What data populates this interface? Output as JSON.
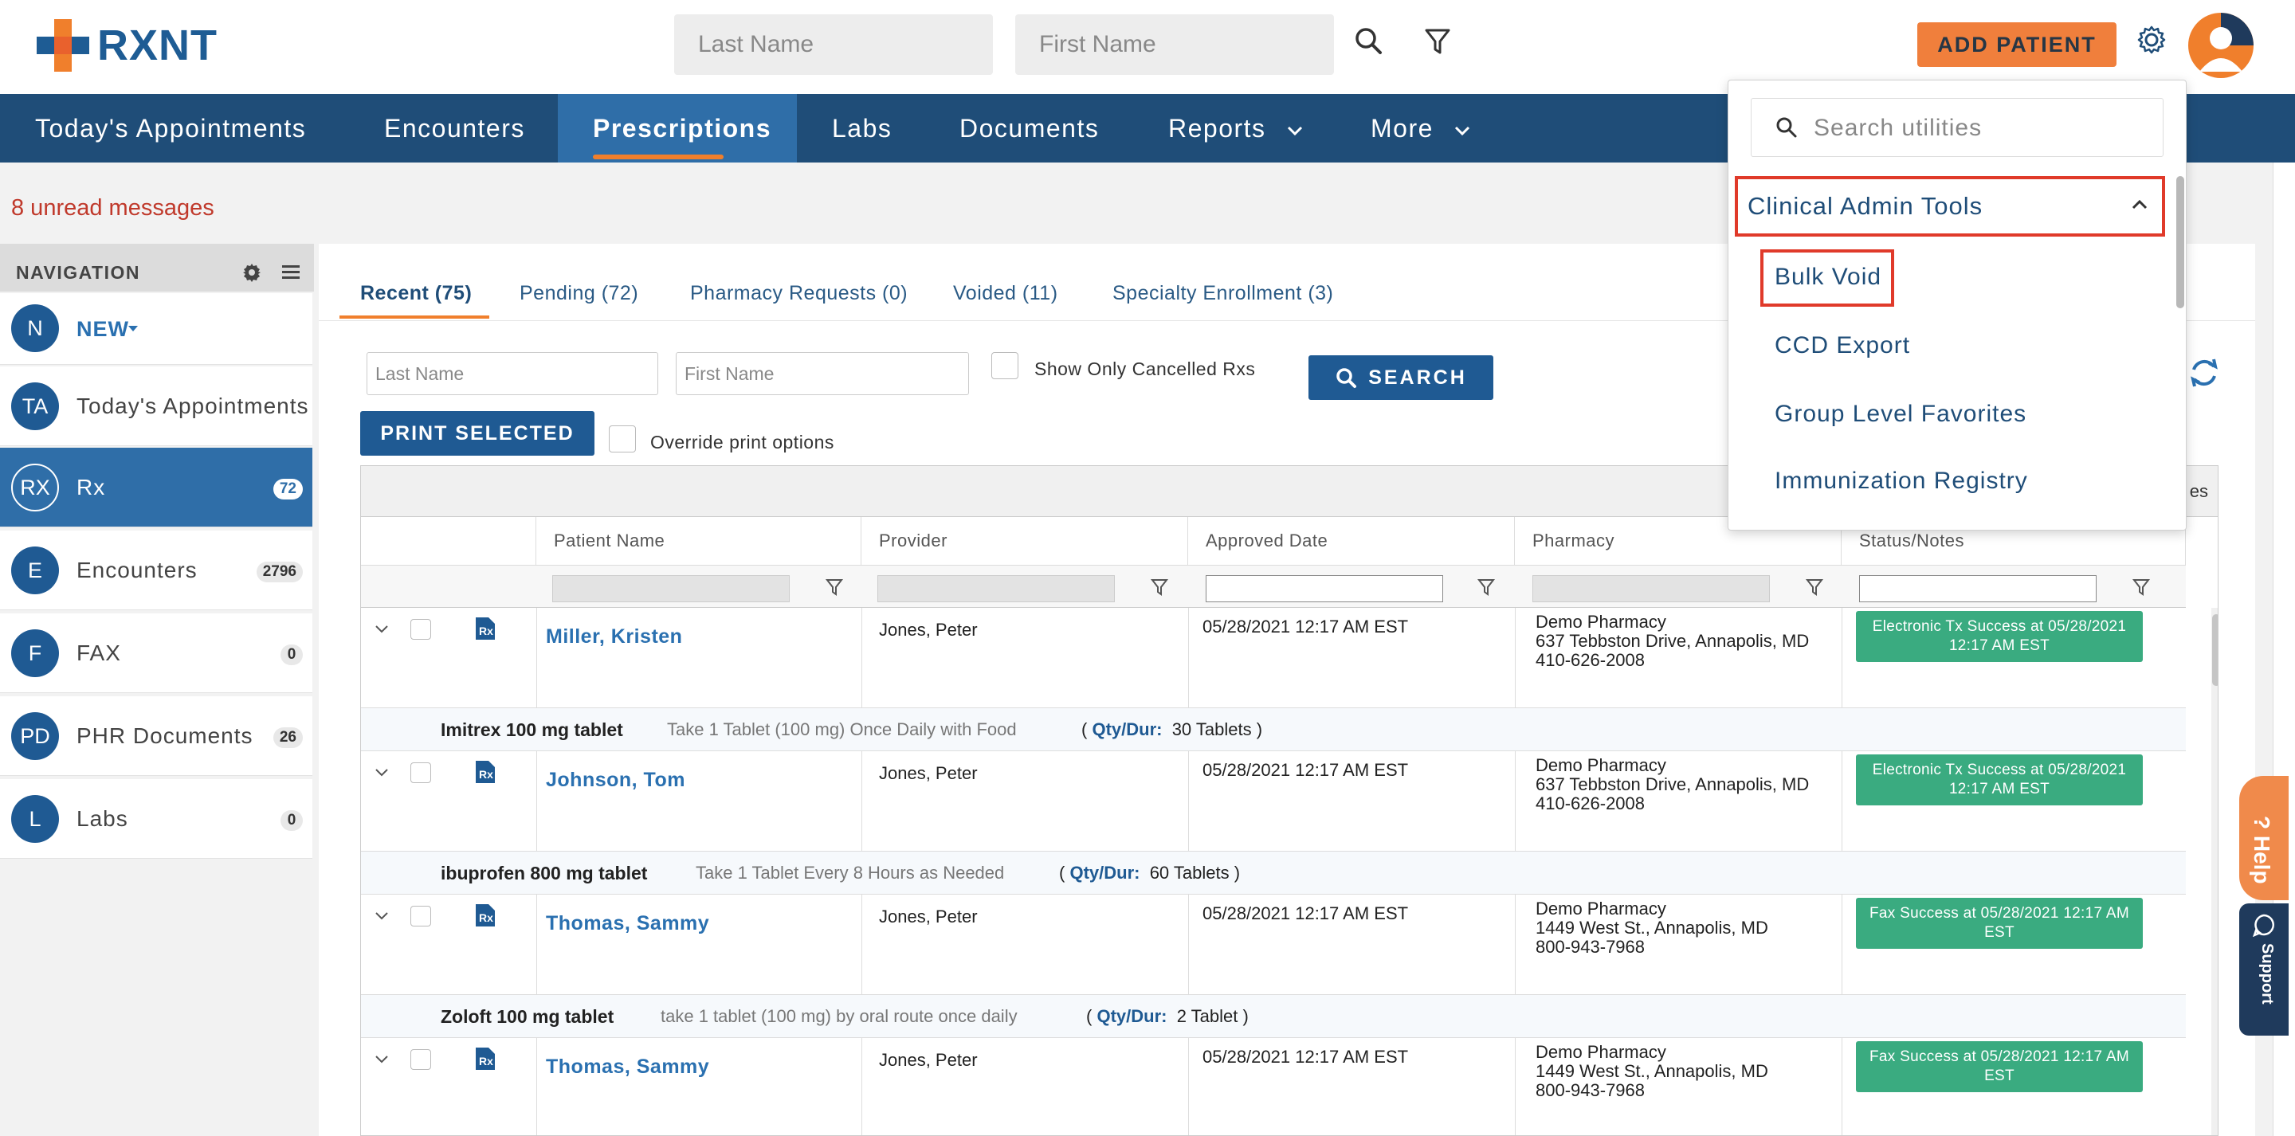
{
  "header": {
    "logo_text": "RXNT",
    "last_name_placeholder": "Last Name",
    "first_name_placeholder": "First Name",
    "add_patient_label": "ADD PATIENT"
  },
  "main_nav": [
    {
      "label": "Today's Appointments"
    },
    {
      "label": "Encounters"
    },
    {
      "label": "Prescriptions"
    },
    {
      "label": "Labs"
    },
    {
      "label": "Documents"
    },
    {
      "label": "Reports"
    },
    {
      "label": "More"
    }
  ],
  "unread_messages": "8 unread messages",
  "left_nav": {
    "title": "NAVIGATION",
    "new_label": "NEW",
    "items": [
      {
        "abbr": "N",
        "label": "NEW"
      },
      {
        "abbr": "TA",
        "label": "Today's Appointments",
        "count": ""
      },
      {
        "abbr": "RX",
        "label": "Rx",
        "count": "72"
      },
      {
        "abbr": "E",
        "label": "Encounters",
        "count": "2796"
      },
      {
        "abbr": "F",
        "label": "FAX",
        "count": "0"
      },
      {
        "abbr": "PD",
        "label": "PHR Documents",
        "count": "26"
      },
      {
        "abbr": "L",
        "label": "Labs",
        "count": "0"
      }
    ]
  },
  "tabs": [
    {
      "label": "Recent (75)"
    },
    {
      "label": "Pending (72)"
    },
    {
      "label": "Pharmacy Requests (0)"
    },
    {
      "label": "Voided (11)"
    },
    {
      "label": "Specialty Enrollment (3)"
    }
  ],
  "filters": {
    "last_name_placeholder": "Last Name",
    "first_name_placeholder": "First Name",
    "cancelled_label": "Show Only Cancelled Rxs",
    "search_label": "SEARCH",
    "print_label": "PRINT SELECTED",
    "override_label": "Override print options"
  },
  "grid": {
    "right_fragment": "es",
    "columns": [
      "Patient Name",
      "Provider",
      "Approved Date",
      "Pharmacy",
      "Status/Notes"
    ],
    "rows": [
      {
        "patient": "Miller, Kristen",
        "provider": "Jones, Peter",
        "date": "05/28/2021 12:17 AM EST",
        "pharmacy_name": "Demo Pharmacy",
        "pharmacy_addr": "637 Tebbston Drive, Annapolis, MD",
        "pharmacy_phone": "410-626-2008",
        "status_line1": "Electronic Tx Success at 05/28/2021",
        "status_line2": "12:17 AM EST",
        "drug": "Imitrex 100 mg tablet",
        "sig": "Take 1 Tablet (100 mg) Once Daily with Food",
        "qty_label": "Qty/Dur:",
        "qty": "30 Tablets"
      },
      {
        "patient": "Johnson, Tom",
        "provider": "Jones, Peter",
        "date": "05/28/2021 12:17 AM EST",
        "pharmacy_name": "Demo Pharmacy",
        "pharmacy_addr": "637 Tebbston Drive, Annapolis, MD",
        "pharmacy_phone": "410-626-2008",
        "status_line1": "Electronic Tx Success at 05/28/2021",
        "status_line2": "12:17 AM EST",
        "drug": "ibuprofen 800 mg tablet",
        "sig": "Take 1 Tablet Every 8 Hours as Needed",
        "qty_label": "Qty/Dur:",
        "qty": "60 Tablets"
      },
      {
        "patient": "Thomas, Sammy",
        "provider": "Jones, Peter",
        "date": "05/28/2021 12:17 AM EST",
        "pharmacy_name": "Demo Pharmacy",
        "pharmacy_addr": "1449 West St., Annapolis, MD",
        "pharmacy_phone": "800-943-7968",
        "status_line1": "Fax Success at 05/28/2021 12:17 AM",
        "status_line2": "EST",
        "drug": "Zoloft 100 mg tablet",
        "sig": "take 1 tablet (100 mg) by oral route once daily",
        "qty_label": "Qty/Dur:",
        "qty": "2 Tablet"
      },
      {
        "patient": "Thomas, Sammy",
        "provider": "Jones, Peter",
        "date": "05/28/2021 12:17 AM EST",
        "pharmacy_name": "Demo Pharmacy",
        "pharmacy_addr": "1449 West St., Annapolis, MD",
        "pharmacy_phone": "800-943-7968",
        "status_line1": "Fax Success at 05/28/2021 12:17 AM",
        "status_line2": "EST"
      }
    ]
  },
  "utilities_dropdown": {
    "search_placeholder": "Search utilities",
    "group_label": "Clinical Admin Tools",
    "items": [
      "Bulk Void",
      "CCD Export",
      "Group Level Favorites",
      "Immunization Registry"
    ]
  },
  "side_tabs": {
    "help": "Help",
    "support": "Support"
  },
  "colors": {
    "brand_blue": "#1f4d78",
    "active_blue": "#2f6ea8",
    "accent_orange": "#f07f2c",
    "status_green": "#3aab80",
    "highlight_red": "#e03a2a"
  }
}
